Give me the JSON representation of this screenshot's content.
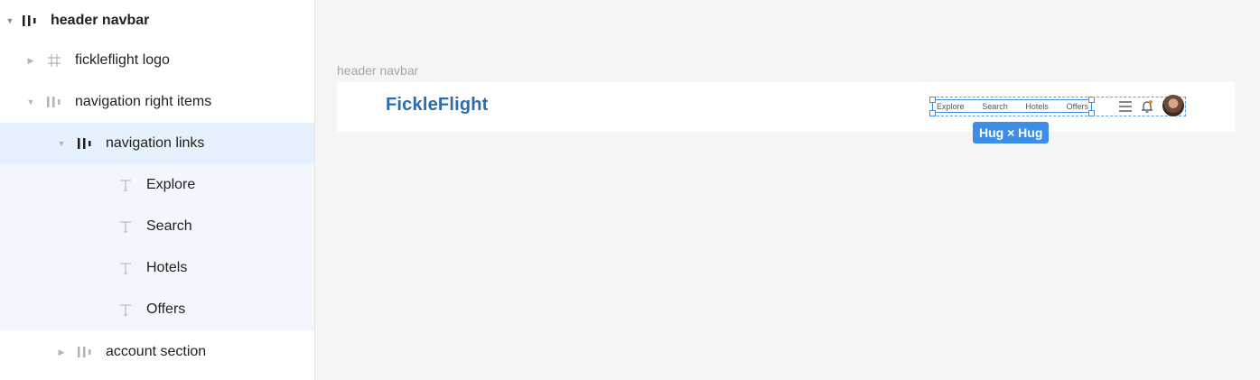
{
  "layers": [
    {
      "label": "header navbar",
      "type": "autolayout",
      "caret": "▼",
      "bold": true
    },
    {
      "label": "fickleflight logo",
      "type": "frame",
      "caret": "▶",
      "bold": false
    },
    {
      "label": "navigation right items",
      "type": "autolayout",
      "caret": "▼",
      "bold": false
    },
    {
      "label": "navigation links",
      "type": "autolayout",
      "caret": "▼",
      "bold": false
    },
    {
      "label": "Explore",
      "type": "text"
    },
    {
      "label": "Search",
      "type": "text"
    },
    {
      "label": "Hotels",
      "type": "text"
    },
    {
      "label": "Offers",
      "type": "text"
    },
    {
      "label": "account section",
      "type": "autolayout",
      "caret": "▶",
      "bold": false
    }
  ],
  "canvas": {
    "frame_label": "header navbar",
    "logo_text": "FickleFlight",
    "links": [
      "Explore",
      "Search",
      "Hotels",
      "Offers"
    ],
    "size_tag": "Hug × Hug"
  },
  "colors": {
    "selection": "#3d8ee6",
    "logo": "#2b6cb0",
    "selected_row": "#e5f1fc",
    "child_row": "#f1f7fd"
  },
  "icons": [
    "caret-down-icon",
    "caret-right-icon",
    "autolayout-icon",
    "frame-icon",
    "text-icon",
    "menu-icon",
    "bell-icon"
  ]
}
